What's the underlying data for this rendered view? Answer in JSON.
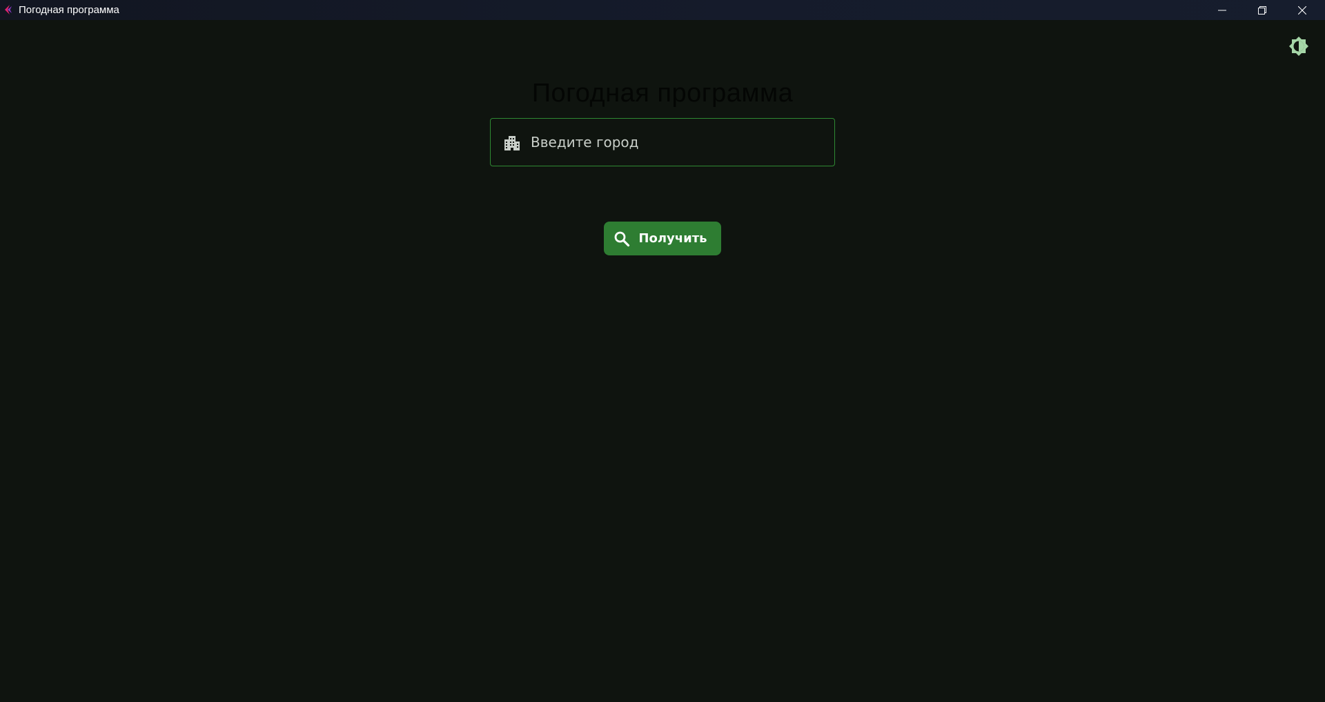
{
  "window": {
    "title": "Погодная программа",
    "app_icon": "flet-logo-icon",
    "controls": {
      "minimize_icon": "minimize-icon",
      "restore_icon": "restore-icon",
      "close_icon": "close-icon"
    }
  },
  "header": {
    "theme_toggle_icon": "brightness-icon"
  },
  "main": {
    "title": "Погодная программа",
    "city_input": {
      "placeholder": "Введите город",
      "value": "",
      "icon": "city-building-icon"
    },
    "get_button": {
      "label": "Получить",
      "icon": "search-icon"
    }
  },
  "colors": {
    "background": "#0f140f",
    "accent": "#2e7d32",
    "input_border": "#2f8a33",
    "theme_icon": "#a5d6a7"
  }
}
